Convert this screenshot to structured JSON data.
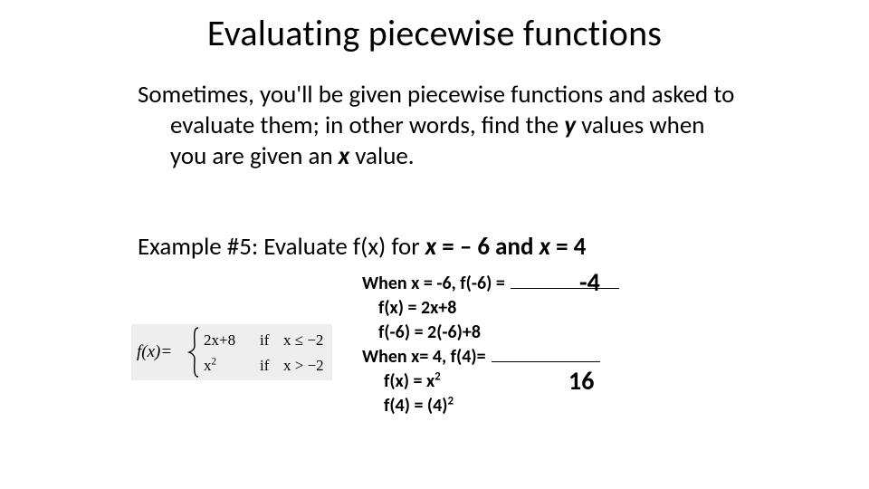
{
  "title": "Evaluating piecewise functions",
  "intro": {
    "pre": "Sometimes, you'll be given piecewise functions and asked to evaluate them; in other words, find the ",
    "y": "y",
    "mid": " values when you are given an ",
    "x": "x",
    "post": " value."
  },
  "example": {
    "prefix": "Example #5: Evaluate f(x) for ",
    "x1var": "x",
    "eq1a": " = ",
    "eq1b": "– 6 and ",
    "x2var": "x",
    "eq2": " = 4"
  },
  "func": {
    "label": "f(x)=",
    "pieces": [
      {
        "expr": "2x+8",
        "if": "if",
        "cond": "x ≤ −2"
      },
      {
        "expr_base": "x",
        "expr_sup": "2",
        "if": "if",
        "cond": "x > −2"
      }
    ]
  },
  "work": {
    "l1_pre": "When x = -6, f(-6) = ",
    "l2": "f(x) = 2x+8",
    "l3": "f(-6) = 2(-6)+8",
    "l4_pre": "When x= 4, f(4)= ",
    "l5_pre": "f(x) = x",
    "l5_sup": "2",
    "l6_pre": "f(4) = (4)",
    "l6_sup": "2"
  },
  "answers": {
    "a1": "-4",
    "a2": "16"
  }
}
